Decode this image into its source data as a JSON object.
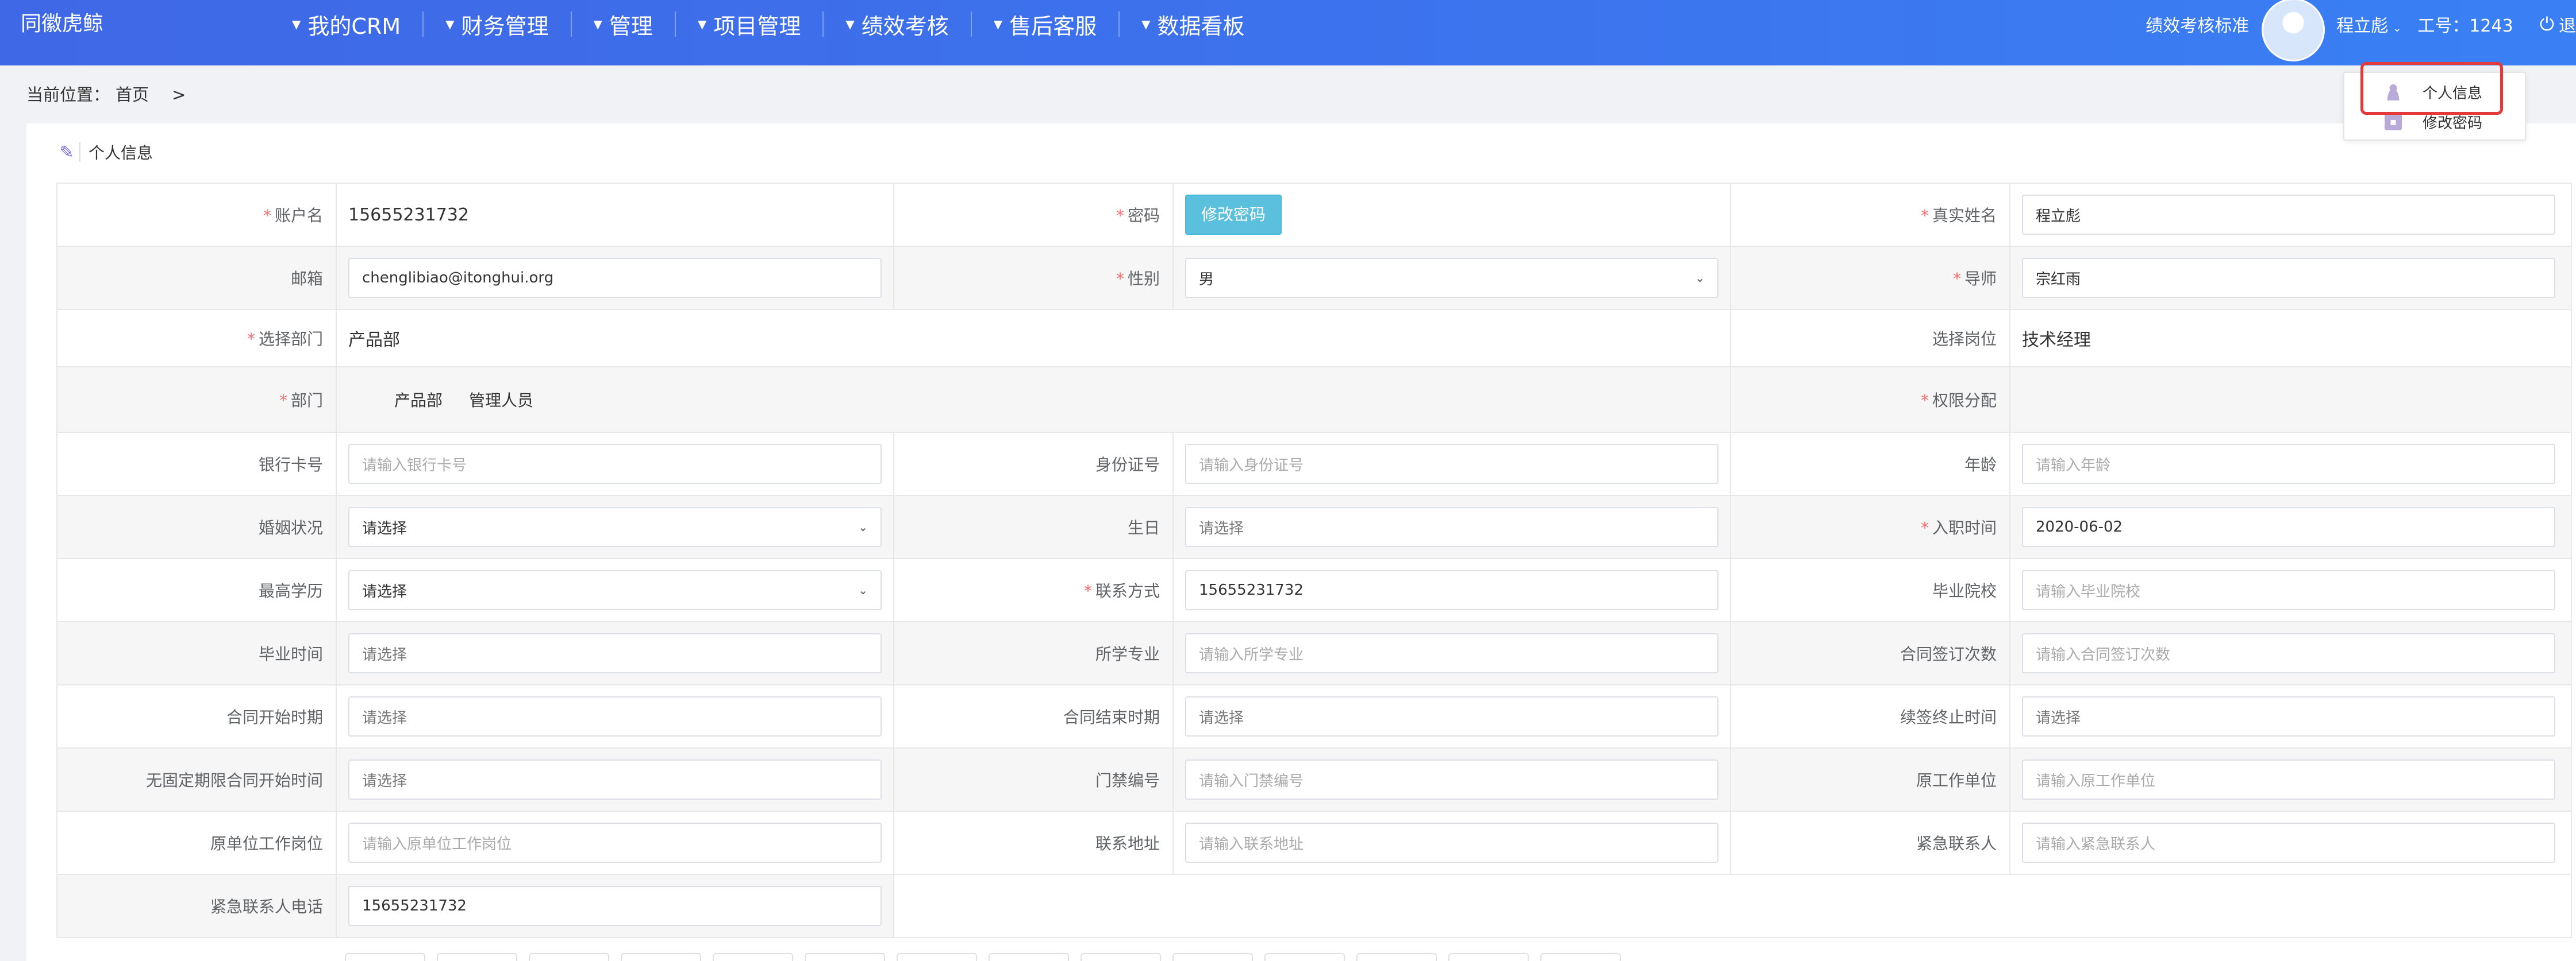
{
  "app": {
    "logo": "同徽虎鲸"
  },
  "nav": [
    {
      "label": "我的CRM"
    },
    {
      "label": "财务管理"
    },
    {
      "label": "管理"
    },
    {
      "label": "项目管理"
    },
    {
      "label": "绩效考核"
    },
    {
      "label": "售后客服"
    },
    {
      "label": "数据看板"
    }
  ],
  "user": {
    "kpi_link": "绩效考核标准",
    "name": "程立彪",
    "employee_id": "工号：1243",
    "logout": "退"
  },
  "breadcrumb": {
    "prefix": "当前位置：",
    "home": "首页",
    "sep": ">"
  },
  "panel": {
    "title": "个人信息"
  },
  "dropdown": {
    "items": [
      {
        "label": "个人信息"
      },
      {
        "label": "修改密码"
      }
    ]
  },
  "form": {
    "account": {
      "label": "账户名",
      "value": "15655231732"
    },
    "password": {
      "label": "密码",
      "button": "修改密码"
    },
    "real_name": {
      "label": "真实姓名",
      "value": "程立彪"
    },
    "email": {
      "label": "邮箱",
      "value": "chenglibiao@itonghui.org"
    },
    "gender": {
      "label": "性别",
      "value": "男"
    },
    "mentor": {
      "label": "导师",
      "value": "宗红雨"
    },
    "dept_select": {
      "label": "选择部门",
      "value": "产品部"
    },
    "post_select": {
      "label": "选择岗位",
      "value": "技术经理"
    },
    "dept": {
      "label": "部门",
      "values": [
        "产品部",
        "管理人员"
      ]
    },
    "perm": {
      "label": "权限分配"
    },
    "bank": {
      "label": "银行卡号",
      "placeholder": "请输入银行卡号"
    },
    "idcard": {
      "label": "身份证号",
      "placeholder": "请输入身份证号"
    },
    "age": {
      "label": "年龄",
      "placeholder": "请输入年龄"
    },
    "marital": {
      "label": "婚姻状况",
      "value": "请选择"
    },
    "birthday": {
      "label": "生日",
      "placeholder": "请选择"
    },
    "join_date": {
      "label": "入职时间",
      "value": "2020-06-02"
    },
    "education": {
      "label": "最高学历",
      "value": "请选择"
    },
    "contact": {
      "label": "联系方式",
      "value": "15655231732"
    },
    "school": {
      "label": "毕业院校",
      "placeholder": "请输入毕业院校"
    },
    "grad_time": {
      "label": "毕业时间",
      "placeholder": "请选择"
    },
    "major": {
      "label": "所学专业",
      "placeholder": "请输入所学专业"
    },
    "contract_times": {
      "label": "合同签订次数",
      "placeholder": "请输入合同签订次数"
    },
    "contract_start": {
      "label": "合同开始时期",
      "placeholder": "请选择"
    },
    "contract_end": {
      "label": "合同结束时期",
      "placeholder": "请选择"
    },
    "renew_end": {
      "label": "续签终止时间",
      "placeholder": "请选择"
    },
    "open_contract": {
      "label": "无固定期限合同开始时间",
      "placeholder": "请选择"
    },
    "access_card": {
      "label": "门禁编号",
      "placeholder": "请输入门禁编号"
    },
    "prev_company": {
      "label": "原工作单位",
      "placeholder": "请输入原工作单位"
    },
    "prev_post": {
      "label": "原单位工作岗位",
      "placeholder": "请输入原单位工作岗位"
    },
    "address": {
      "label": "联系地址",
      "placeholder": "请输入联系地址"
    },
    "emergency_contact": {
      "label": "紧急联系人",
      "placeholder": "请输入紧急联系人"
    },
    "emergency_phone": {
      "label": "紧急联系人电话",
      "value": "15655231732"
    }
  }
}
